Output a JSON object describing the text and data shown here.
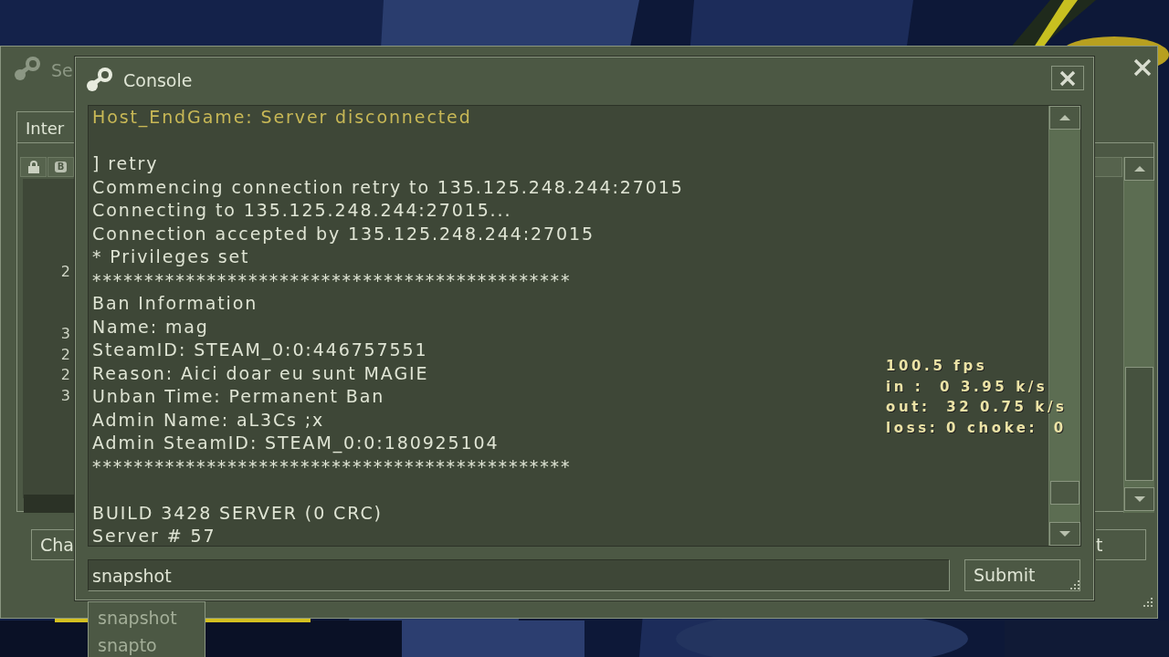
{
  "back_window": {
    "title": "Se",
    "tab": "Inter",
    "header_badge": "B",
    "rows": [
      {
        "kind": "blank"
      },
      {
        "kind": "blank"
      },
      {
        "kind": "blank"
      },
      {
        "kind": "blank"
      },
      {
        "kind": "row",
        "text": "2"
      },
      {
        "kind": "blank"
      },
      {
        "kind": "blank"
      },
      {
        "kind": "row",
        "text": "3"
      },
      {
        "kind": "row",
        "text": "2"
      },
      {
        "kind": "row",
        "text": "2"
      },
      {
        "kind": "row",
        "text": "3"
      }
    ],
    "buttons": [
      "Cha",
      "t"
    ]
  },
  "console": {
    "title": "Console",
    "lines": [
      {
        "kind": "highlight",
        "text": "Host_EndGame: Server disconnected"
      },
      {
        "kind": "blank"
      },
      {
        "kind": "normal",
        "text": "] retry"
      },
      {
        "kind": "normal",
        "text": "Commencing connection retry to 135.125.248.244:27015"
      },
      {
        "kind": "normal",
        "text": "Connecting to 135.125.248.244:27015..."
      },
      {
        "kind": "normal",
        "text": "Connection accepted by 135.125.248.244:27015"
      },
      {
        "kind": "normal",
        "text": "* Privileges set"
      },
      {
        "kind": "normal",
        "text": "**********************************************"
      },
      {
        "kind": "normal",
        "text": "Ban Information"
      },
      {
        "kind": "normal",
        "text": "Name: mag"
      },
      {
        "kind": "normal",
        "text": "SteamID: STEAM_0:0:446757551"
      },
      {
        "kind": "normal",
        "text": "Reason: Aici doar eu sunt MAGIE"
      },
      {
        "kind": "normal",
        "text": "Unban Time: Permanent Ban"
      },
      {
        "kind": "normal",
        "text": "Admin Name: aL3Cs ;x"
      },
      {
        "kind": "normal",
        "text": "Admin SteamID: STEAM_0:0:180925104"
      },
      {
        "kind": "normal",
        "text": "**********************************************"
      },
      {
        "kind": "blank"
      },
      {
        "kind": "normal",
        "text": "BUILD 3428 SERVER (0 CRC)"
      },
      {
        "kind": "normal",
        "text": "Server # 57"
      }
    ],
    "input": {
      "value": "snapshot"
    },
    "submit": "Submit",
    "suggestions": [
      "snapshot",
      "snapto"
    ]
  },
  "net_graph": [
    "100.5 fps",
    "in :  0 3.95 k/s",
    "out:  32 0.75 k/s",
    "loss: 0 choke:  0"
  ]
}
